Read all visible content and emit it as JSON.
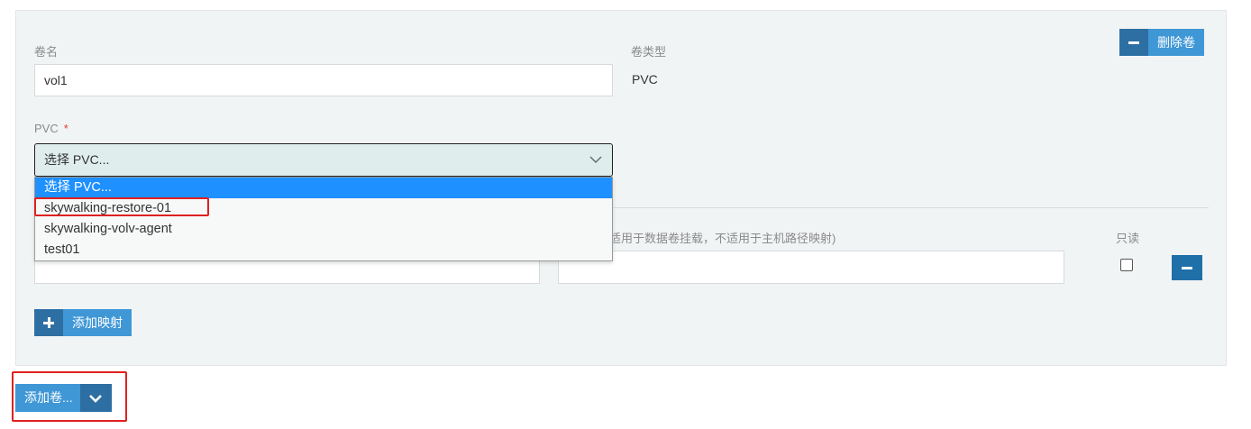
{
  "volume": {
    "name_label": "卷名",
    "name_value": "vol1",
    "type_label": "卷类型",
    "type_value": "PVC",
    "delete_button": "删除卷"
  },
  "pvc": {
    "label": "PVC",
    "required_mark": "*",
    "selected": "选择 PVC...",
    "options": [
      "选择 PVC...",
      "skywalking-restore-01",
      "skywalking-volv-agent",
      "test01"
    ]
  },
  "mapping": {
    "subpath_label_partial": "适用于数据卷挂载，不适用于主机路径映射)",
    "readonly_label": "只读",
    "add_mapping_button": "添加映射"
  },
  "footer": {
    "add_volume_button": "添加卷..."
  },
  "colors": {
    "primary": "#3f97d6",
    "primary_dark": "#2e6fa3",
    "highlight_red": "#e02020",
    "dropdown_selected": "#1e90ff"
  }
}
